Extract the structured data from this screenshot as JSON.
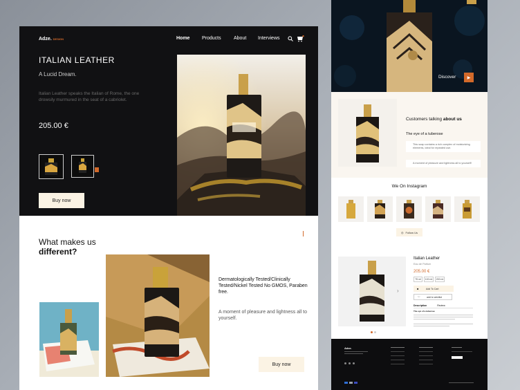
{
  "left": {
    "logo": "Adze.",
    "logo_sub": "DESIGN",
    "nav": [
      "Home",
      "Products",
      "About",
      "Interviews"
    ],
    "hero": {
      "title": "ITALIAN LEATHER",
      "subtitle": "A Lucid Dream.",
      "description": "Italian Leather speaks the Italian of Rome, the one drowsily murmured in the seat of a cabriolet.",
      "price": "205.00 €",
      "buy_label": "Buy now"
    },
    "section2": {
      "title_line1": "What makes us",
      "title_line2": "different?",
      "feature": "Dermatologically Tested/Clinically Tested/Nickel Tested No GMOS, Paraben free.",
      "desc": "A moment of pleasure and lightness all to yourself.",
      "buy_label": "Buy now"
    }
  },
  "right": {
    "discover_label": "Discover",
    "testimonials": {
      "title_prefix": "Customers talking",
      "title_bold": "about us",
      "heading": "The eye of a tuberose",
      "quote1": "This soap contains a rich complex of moisturizing elements, ideal for repeated use.",
      "quote2": "A moment of pleasure and lightness all to yourself!"
    },
    "instagram": {
      "title": "We On Instagram",
      "follow_label": "Follow Us"
    },
    "product": {
      "name": "Italian Leather",
      "subtitle": "Eau de Parfum",
      "price": "205.00 €",
      "sizes": [
        "75 ml",
        "100 ml",
        "200 ml"
      ],
      "add_to_cart": "Add To Cart",
      "wishlist": "add to wishlist",
      "tabs": [
        "Description",
        "Review"
      ],
      "desc_title": "The eye of a tuberose"
    },
    "footer": {
      "logo": "Adze."
    }
  },
  "colors": {
    "accent": "#d2692a",
    "cream": "#fbf3e4",
    "dark": "#111113"
  }
}
